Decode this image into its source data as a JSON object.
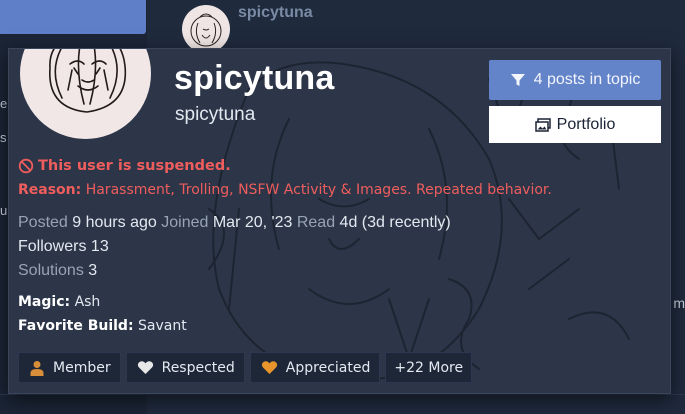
{
  "background": {
    "post_username": "spicytuna",
    "edge_left_chars": [
      "er",
      "s",
      "u"
    ],
    "edge_right_char": "m"
  },
  "card": {
    "title": "spicytuna",
    "subtitle": "spicytuna",
    "filter_button_label": "4 posts in topic",
    "portfolio_button_label": "Portfolio",
    "suspended_text": "This user is suspended.",
    "reason_label": "Reason:",
    "reason_text": "Harassment, Trolling, NSFW Activity & Images. Repeated behavior.",
    "posted_label": "Posted",
    "posted_value": "9 hours ago",
    "joined_label": "Joined",
    "joined_value": "Mar 20, '23",
    "read_label": "Read",
    "read_value": "4d (3d recently)",
    "followers_label": "Followers",
    "followers_value": "13",
    "solutions_label": "Solutions",
    "solutions_value": "3",
    "magic_label": "Magic:",
    "magic_value": "Ash",
    "build_label": "Favorite Build:",
    "build_value": "Savant",
    "badges": [
      {
        "label": "Member",
        "icon": "user-icon",
        "color": "#d98e3a"
      },
      {
        "label": "Respected",
        "icon": "heart-icon",
        "color": "#e8e8e8"
      },
      {
        "label": "Appreciated",
        "icon": "heart-icon",
        "color": "#e8952c"
      }
    ],
    "more_badges_label": "+22 More"
  },
  "colors": {
    "accent": "#6484c9",
    "danger": "#ef5d5d",
    "card_bg": "#2c3648"
  }
}
